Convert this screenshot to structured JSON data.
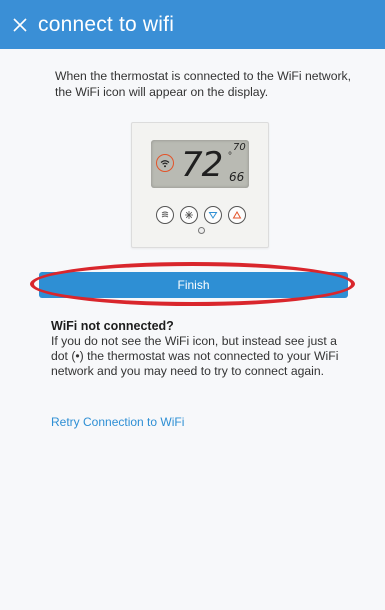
{
  "header": {
    "title": "connect to wifi",
    "close_icon": "close-icon",
    "background": "#3a8fd6"
  },
  "intro_text": "When the thermostat is connected to the WiFi network, the WiFi icon will appear on the display.",
  "thermostat": {
    "current_temp": "72",
    "degree": "°",
    "setpoint": "70",
    "outdoor": "66",
    "icons": [
      "wifi-icon",
      "fan-icon",
      "mode-icon",
      "down-arrow-icon",
      "up-arrow-icon"
    ]
  },
  "finish_button": {
    "label": "Finish",
    "color": "#2e8fd4",
    "highlight_color": "#d9262c"
  },
  "not_connected": {
    "title": "WiFi not connected?",
    "text": "If you do not see the WiFi icon, but instead see just a dot (•) the thermostat was not connected to your WiFi network and you may need to try to connect again."
  },
  "retry_link": "Retry Connection to WiFi"
}
